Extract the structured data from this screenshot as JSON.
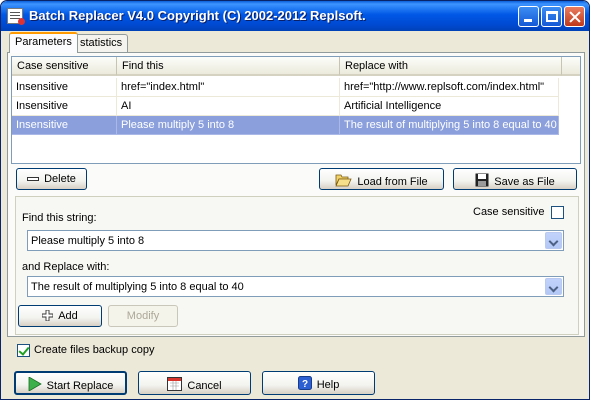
{
  "window": {
    "title": "Batch Replacer V4.0 Copyright (C) 2002-2012 Replsoft."
  },
  "tabs": [
    {
      "label": "Parameters",
      "active": true
    },
    {
      "label": "statistics",
      "active": false
    }
  ],
  "table": {
    "columns": [
      "Case sensitive",
      "Find this",
      "Replace with"
    ],
    "rows": [
      {
        "case": "Insensitive",
        "find": "href=\"index.html\"",
        "replace": "href=\"http://www.replsoft.com/index.html\"",
        "selected": false
      },
      {
        "case": "Insensitive",
        "find": "AI",
        "replace": "Artificial Intelligence",
        "selected": false
      },
      {
        "case": "Insensitive",
        "find": "Please multiply 5 into 8",
        "replace": "The result of multiplying 5 into 8 equal to 40",
        "selected": true
      }
    ]
  },
  "buttons": {
    "delete": "Delete",
    "load": "Load from File",
    "save": "Save as File",
    "add": "Add",
    "modify": "Modify",
    "start": "Start Replace",
    "cancel": "Cancel",
    "help": "Help"
  },
  "form": {
    "find_label": "Find this string:",
    "find_value": "Please multiply 5 into 8",
    "replace_label": "and Replace with:",
    "replace_value": "The result of multiplying 5 into 8 equal to 40",
    "case_label": "Case sensitive",
    "case_checked": false,
    "backup_label": "Create files backup copy",
    "backup_checked": true
  },
  "icons": {
    "delete": "minus-icon",
    "load": "open-folder-icon",
    "save": "floppy-disk-icon",
    "add": "plus-icon",
    "start": "play-icon",
    "cancel": "calendar-icon",
    "help": "help-icon"
  },
  "colors": {
    "titlebar": "#0058e6",
    "selected_row": "#8a9fdc",
    "accent_tab": "#ff9a00"
  }
}
